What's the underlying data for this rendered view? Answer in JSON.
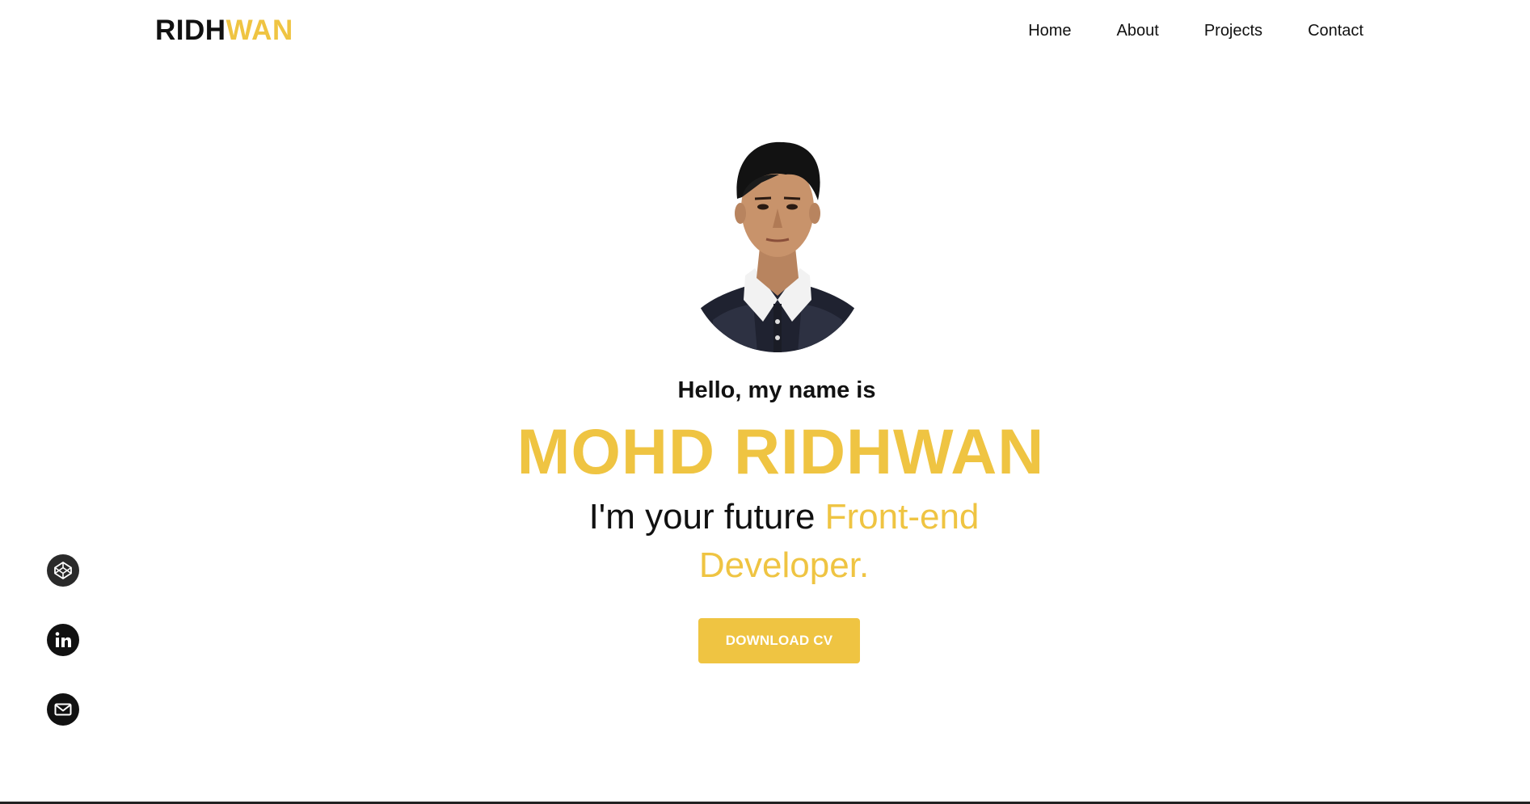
{
  "header": {
    "logo_part1": "RIDH",
    "logo_part2": "WAN",
    "nav": [
      "Home",
      "About",
      "Projects",
      "Contact"
    ]
  },
  "hero": {
    "greeting": "Hello, my name is",
    "name": "MOHD RIDHWAN",
    "tagline_plain": "I'm your future ",
    "tagline_accent": "Front-end Developer.",
    "cv_button": "DOWNLOAD CV"
  },
  "social": {
    "icons": [
      "codepen-icon",
      "linkedin-icon",
      "mail-icon"
    ]
  },
  "colors": {
    "accent": "#EFC442",
    "text": "#111111",
    "background": "#ffffff"
  }
}
